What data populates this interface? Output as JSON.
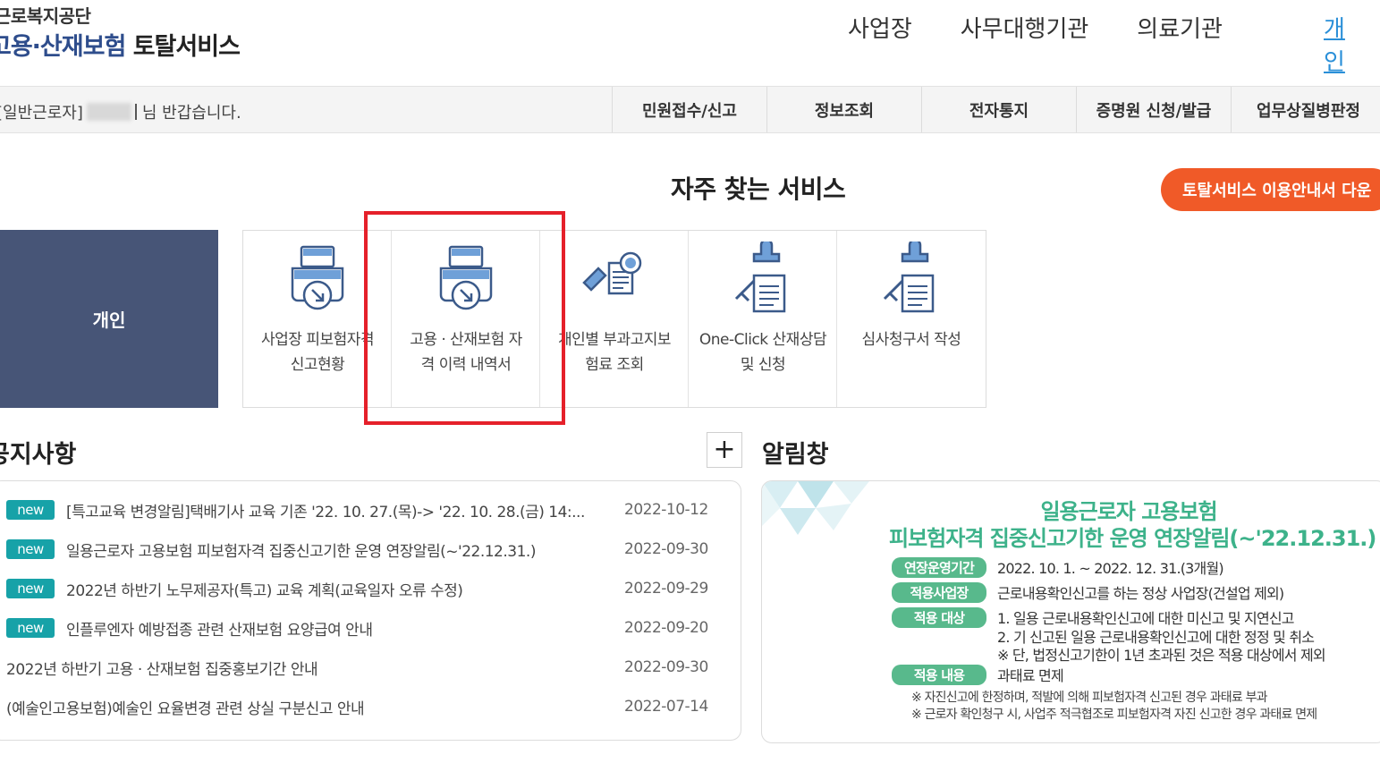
{
  "header": {
    "org_name": "근로복지공단",
    "service_title_blue": "고용·산재보험",
    "service_title_dark": "토탈서비스",
    "nav": [
      {
        "label": "사업장"
      },
      {
        "label": "사무대행기관"
      },
      {
        "label": "의료기관"
      },
      {
        "label": "개인"
      }
    ]
  },
  "subbar": {
    "greeting_prefix": "[일반근로자]",
    "greeting_suffix": "님 반갑습니다.",
    "menu": [
      {
        "label": "민원접수/신고"
      },
      {
        "label": "정보조회"
      },
      {
        "label": "전자통지"
      },
      {
        "label": "증명원 신청/발급"
      },
      {
        "label": "업무상질병판정"
      }
    ]
  },
  "frequent": {
    "title": "자주 찾는 서비스",
    "guide_button": "토탈서비스 이용안내서 다운",
    "panel_label": "개인",
    "tiles": [
      {
        "label": "사업장 피보험자격\n신고현황",
        "icon": "printer-download-icon"
      },
      {
        "label": "고용 · 산재보험 자\n격 이력 내역서",
        "icon": "printer-download-icon"
      },
      {
        "label": "개인별 부과고지보\n험료 조회",
        "icon": "search-document-icon"
      },
      {
        "label": "One-Click 산재상담\n및 신청",
        "icon": "stamp-document-icon"
      },
      {
        "label": "심사청구서 작성",
        "icon": "stamp-document-icon"
      }
    ]
  },
  "notices": {
    "title": "공지사항",
    "more_label": "+",
    "items": [
      {
        "new": "new",
        "text": "[특고교육 변경알림]택배기사 교육 기존 '22. 10. 27.(목)-> '22. 10. 28.(금) 14:...",
        "date": "2022-10-12"
      },
      {
        "new": "new",
        "text": "일용근로자 고용보험 피보험자격 집중신고기한 운영 연장알림(~'22.12.31.)",
        "date": "2022-09-30"
      },
      {
        "new": "new",
        "text": "2022년 하반기 노무제공자(특고) 교육 계획(교육일자 오류 수정)",
        "date": "2022-09-29"
      },
      {
        "new": "new",
        "text": "인플루엔자 예방접종 관련 산재보험 요양급여 안내",
        "date": "2022-09-20"
      },
      {
        "new": "",
        "text": "2022년 하반기 고용 · 산재보험 집중홍보기간 안내",
        "date": "2022-09-30"
      },
      {
        "new": "",
        "text": "(예술인고용보험)예술인 요율변경 관련 상실 구분신고 안내",
        "date": "2022-07-14"
      }
    ]
  },
  "alert": {
    "title": "알림창",
    "headline1": "일용근로자 고용보험",
    "headline2": "피보험자격 집중신고기한 운영 연장알림(~'22.12.31.)",
    "rows": [
      {
        "tag": "연장운영기간",
        "text": "2022. 10. 1. ~ 2022. 12. 31.(3개월)"
      },
      {
        "tag": "적용사업장",
        "text": "근로내용확인신고를 하는 정상 사업장(건설업 제외)"
      },
      {
        "tag": "적용 대상",
        "text": "1. 일용 근로내용확인신고에 대한 미신고 및 지연신고"
      },
      {
        "tag": "적용 내용",
        "text": "과태료 면제"
      }
    ],
    "sub_lines": [
      "2. 기 신고된 일용 근로내용확인신고에 대한 정정 및 취소",
      "※ 단, 법정신고기한이 1년 초과된 것은 적용 대상에서 제외"
    ],
    "footnotes": [
      "※ 자진신고에 한정하며, 적발에 의해 피보험자격 신고된 경우 과태료 부과",
      "※ 근로자 확인청구 시, 사업주 적극협조로 피보험자격 자진 신고한 경우 과태료 면제"
    ]
  }
}
